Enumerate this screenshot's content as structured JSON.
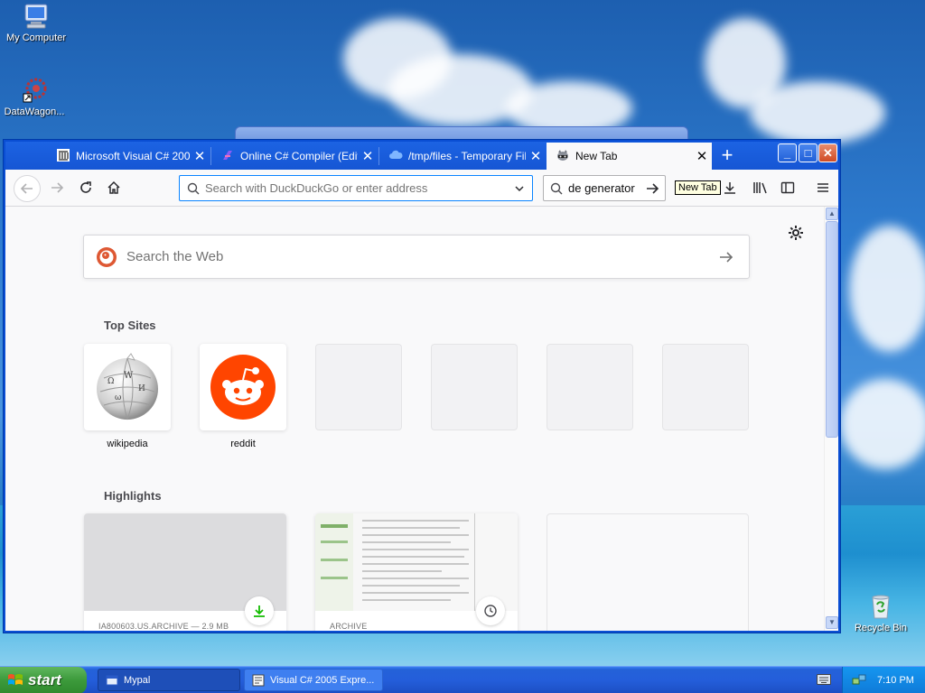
{
  "desktop": {
    "icons": [
      {
        "label": "My Computer"
      },
      {
        "label": "DataWagon..."
      }
    ],
    "recycle_bin": "Recycle Bin"
  },
  "browser": {
    "tabs": [
      {
        "label": "Microsoft Visual C# 2005 E",
        "icon": "library-icon"
      },
      {
        "label": "Online C# Compiler (Edito",
        "icon": "compiler-icon"
      },
      {
        "label": "/tmp/files - Temporary File",
        "icon": "cloud-icon"
      },
      {
        "label": "New Tab",
        "icon": "raccoon-icon"
      }
    ],
    "new_tab_symbol": "+",
    "url_placeholder": "Search with DuckDuckGo or enter address",
    "search_value": "de generator",
    "tooltip": "New Tab",
    "window_buttons": {
      "minimize": "_",
      "maximize": "□",
      "close": "✕"
    }
  },
  "newtab": {
    "web_search_placeholder": "Search the Web",
    "top_sites_title": "Top Sites",
    "top_sites": [
      {
        "label": "wikipedia"
      },
      {
        "label": "reddit"
      },
      {
        "label": ""
      },
      {
        "label": ""
      },
      {
        "label": ""
      },
      {
        "label": ""
      }
    ],
    "highlights_title": "Highlights",
    "highlights": [
      {
        "meta": "IA800603.US.ARCHIVE — 2.9 MB"
      },
      {
        "meta": "ARCHIVE"
      },
      {
        "meta": ""
      }
    ]
  },
  "taskbar": {
    "start": "start",
    "items": [
      {
        "label": "Mypal"
      },
      {
        "label": "Visual C# 2005 Expre..."
      }
    ],
    "clock": "7:10 PM"
  }
}
